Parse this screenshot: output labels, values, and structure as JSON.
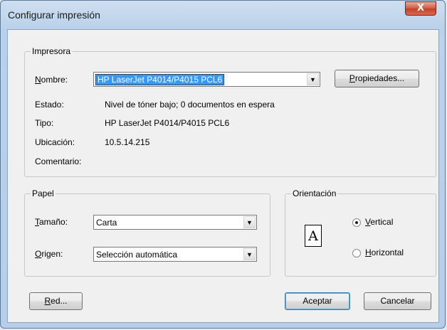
{
  "window": {
    "title": "Configurar impresión",
    "close_symbol": "X"
  },
  "printer": {
    "group_label": "Impresora",
    "name_label_u": "N",
    "name_label_rest": "ombre:",
    "name_value": "HP LaserJet P4014/P4015 PCL6",
    "properties_u": "P",
    "properties_rest": "ropiedades...",
    "status_label": "Estado:",
    "status_value": "Nivel de tóner bajo; 0 documentos en espera",
    "type_label": "Tipo:",
    "type_value": "HP LaserJet P4014/P4015 PCL6",
    "location_label": "Ubicación:",
    "location_value": "10.5.14.215",
    "comment_label": "Comentario:",
    "comment_value": ""
  },
  "paper": {
    "group_label": "Papel",
    "size_label_u": "T",
    "size_label_rest": "amaño:",
    "size_value": "Carta",
    "source_label_u": "O",
    "source_label_rest": "rigen:",
    "source_value": "Selección automática"
  },
  "orientation": {
    "group_label": "Orientación",
    "icon_letter": "A",
    "vertical_u": "V",
    "vertical_rest": "ertical",
    "horizontal_u": "H",
    "horizontal_rest": "orizontal",
    "selected": "vertical"
  },
  "buttons": {
    "network_u": "R",
    "network_rest": "ed...",
    "ok": "Aceptar",
    "cancel": "Cancelar"
  },
  "colors": {
    "selection": "#3399ff",
    "close_button": "#c2412a"
  }
}
